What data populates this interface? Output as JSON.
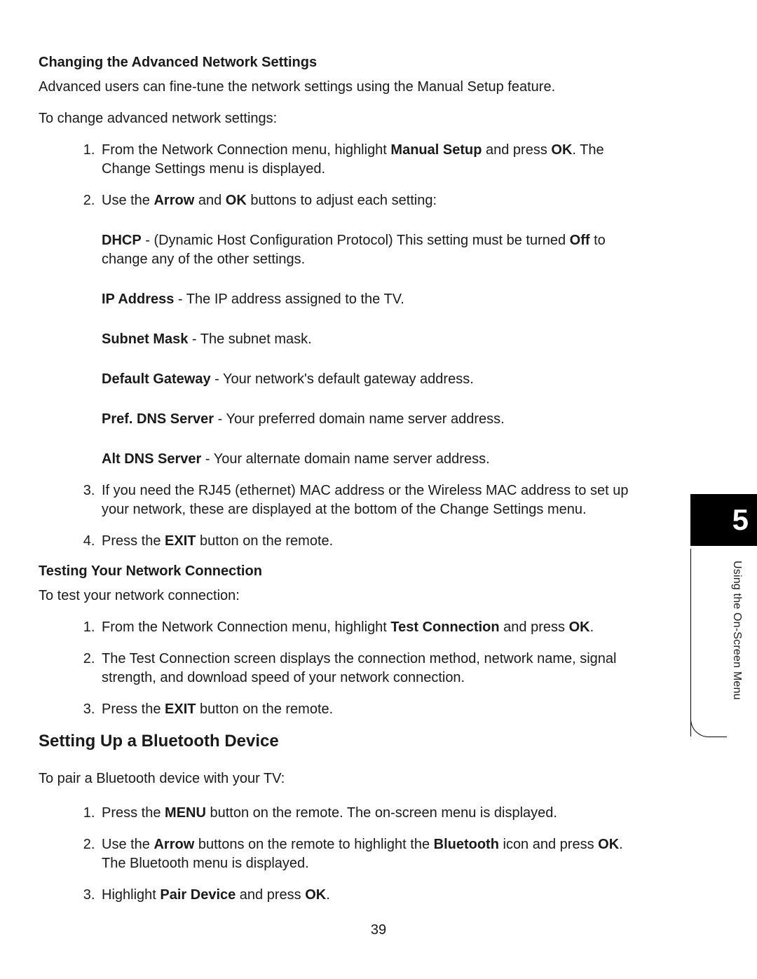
{
  "section1": {
    "heading": "Changing the Advanced Network Settings",
    "intro": "Advanced users can fine-tune the network settings using the Manual Setup feature.",
    "lead": "To change advanced network settings:",
    "step1a": "From the Network Connection menu, highlight ",
    "step1b": "Manual Setup",
    "step1c": " and press ",
    "step1d": "OK",
    "step1e": ". The Change Settings menu is displayed.",
    "step2a": "Use the ",
    "step2b": "Arrow",
    "step2c": " and ",
    "step2d": "OK",
    "step2e": " buttons to adjust each setting:",
    "defs": {
      "dhcp_l": "DHCP",
      "dhcp_a": " - (Dynamic Host Configuration Protocol) This setting must be turned ",
      "dhcp_b": "Off",
      "dhcp_c": " to change any of the other settings.",
      "ip_l": "IP Address",
      "ip_t": " - The IP address assigned to the TV.",
      "sm_l": "Subnet Mask",
      "sm_t": " - The subnet mask.",
      "gw_l": "Default Gateway",
      "gw_t": " - Your network's default gateway address.",
      "p_l": "Pref. DNS Server",
      "p_t": " - Your preferred domain name server address.",
      "a_l": "Alt DNS Server",
      "a_t": " - Your alternate domain name server address."
    },
    "step3": "If you need the RJ45 (ethernet) MAC address or the Wireless MAC address to set up your network, these are displayed at the bottom of the Change Settings menu.",
    "step4a": "Press the ",
    "step4b": "EXIT",
    "step4c": " button on the remote."
  },
  "section2": {
    "heading": "Testing Your Network Connection",
    "lead": "To test your network connection:",
    "s1a": "From the Network Connection menu, highlight ",
    "s1b": "Test Connection",
    "s1c": " and press ",
    "s1d": "OK",
    "s1e": ".",
    "s2": "The Test Connection screen displays the connection method, network name, signal strength, and download speed of your network connection.",
    "s3a": "Press the ",
    "s3b": "EXIT",
    "s3c": " button on the remote."
  },
  "section3": {
    "heading": "Setting Up a Bluetooth Device",
    "lead": "To pair a Bluetooth device with your TV:",
    "s1a": "Press the ",
    "s1b": "MENU",
    "s1c": " button on the remote. The on-screen menu is displayed.",
    "s2a": "Use the ",
    "s2b": "Arrow",
    "s2c": " buttons on the remote to highlight the ",
    "s2d": "Bluetooth",
    "s2e": " icon and press ",
    "s2f": "OK",
    "s2g": ". The Bluetooth menu is displayed.",
    "s3a": "Highlight ",
    "s3b": "Pair Device",
    "s3c": " and press ",
    "s3d": "OK",
    "s3e": "."
  },
  "tab": {
    "chapter": "5",
    "title": "Using the On-Screen Menu"
  },
  "page_number": "39"
}
